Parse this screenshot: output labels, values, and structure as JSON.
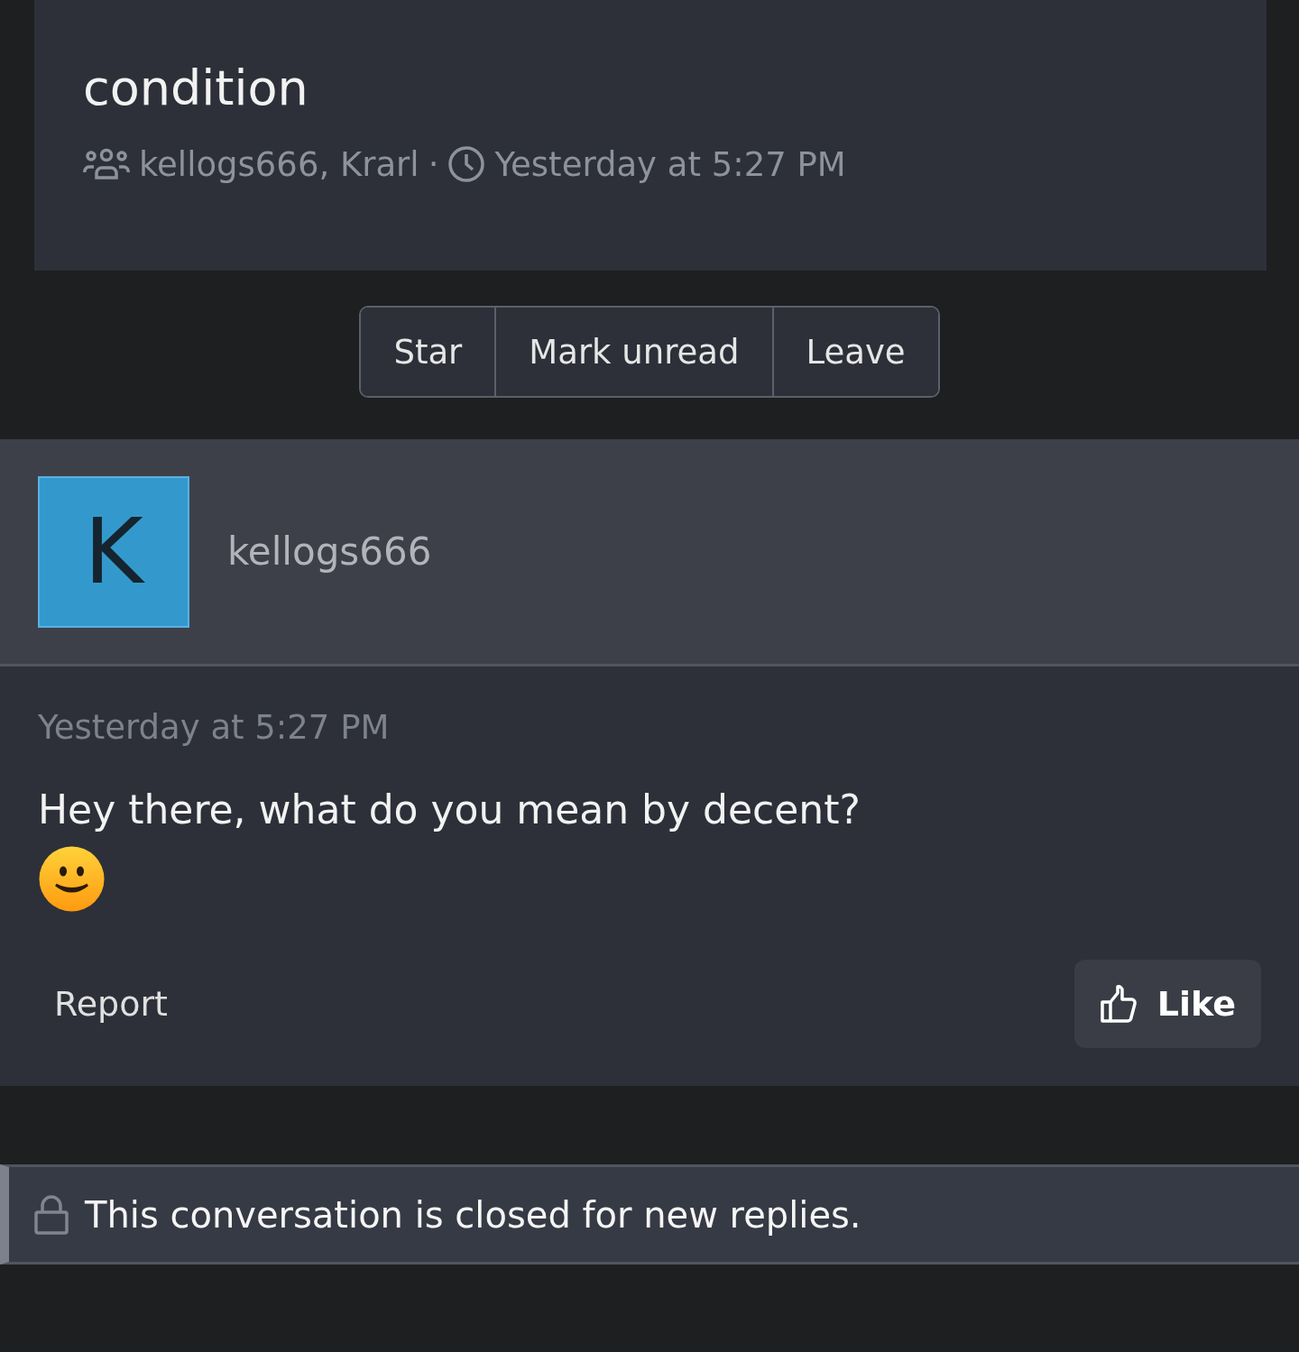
{
  "conversation": {
    "title": "condition",
    "participants": "kellogs666, Krarl",
    "separator": "·",
    "started": "Yesterday at 5:27 PM"
  },
  "actions": [
    {
      "label": "Star"
    },
    {
      "label": "Mark unread"
    },
    {
      "label": "Leave"
    }
  ],
  "message": {
    "avatar_letter": "K",
    "author": "kellogs666",
    "time": "Yesterday at 5:27 PM",
    "text": "Hey there, what do you mean by decent?",
    "report": "Report",
    "like": "Like"
  },
  "notice": {
    "text": "This conversation is closed for new replies."
  }
}
